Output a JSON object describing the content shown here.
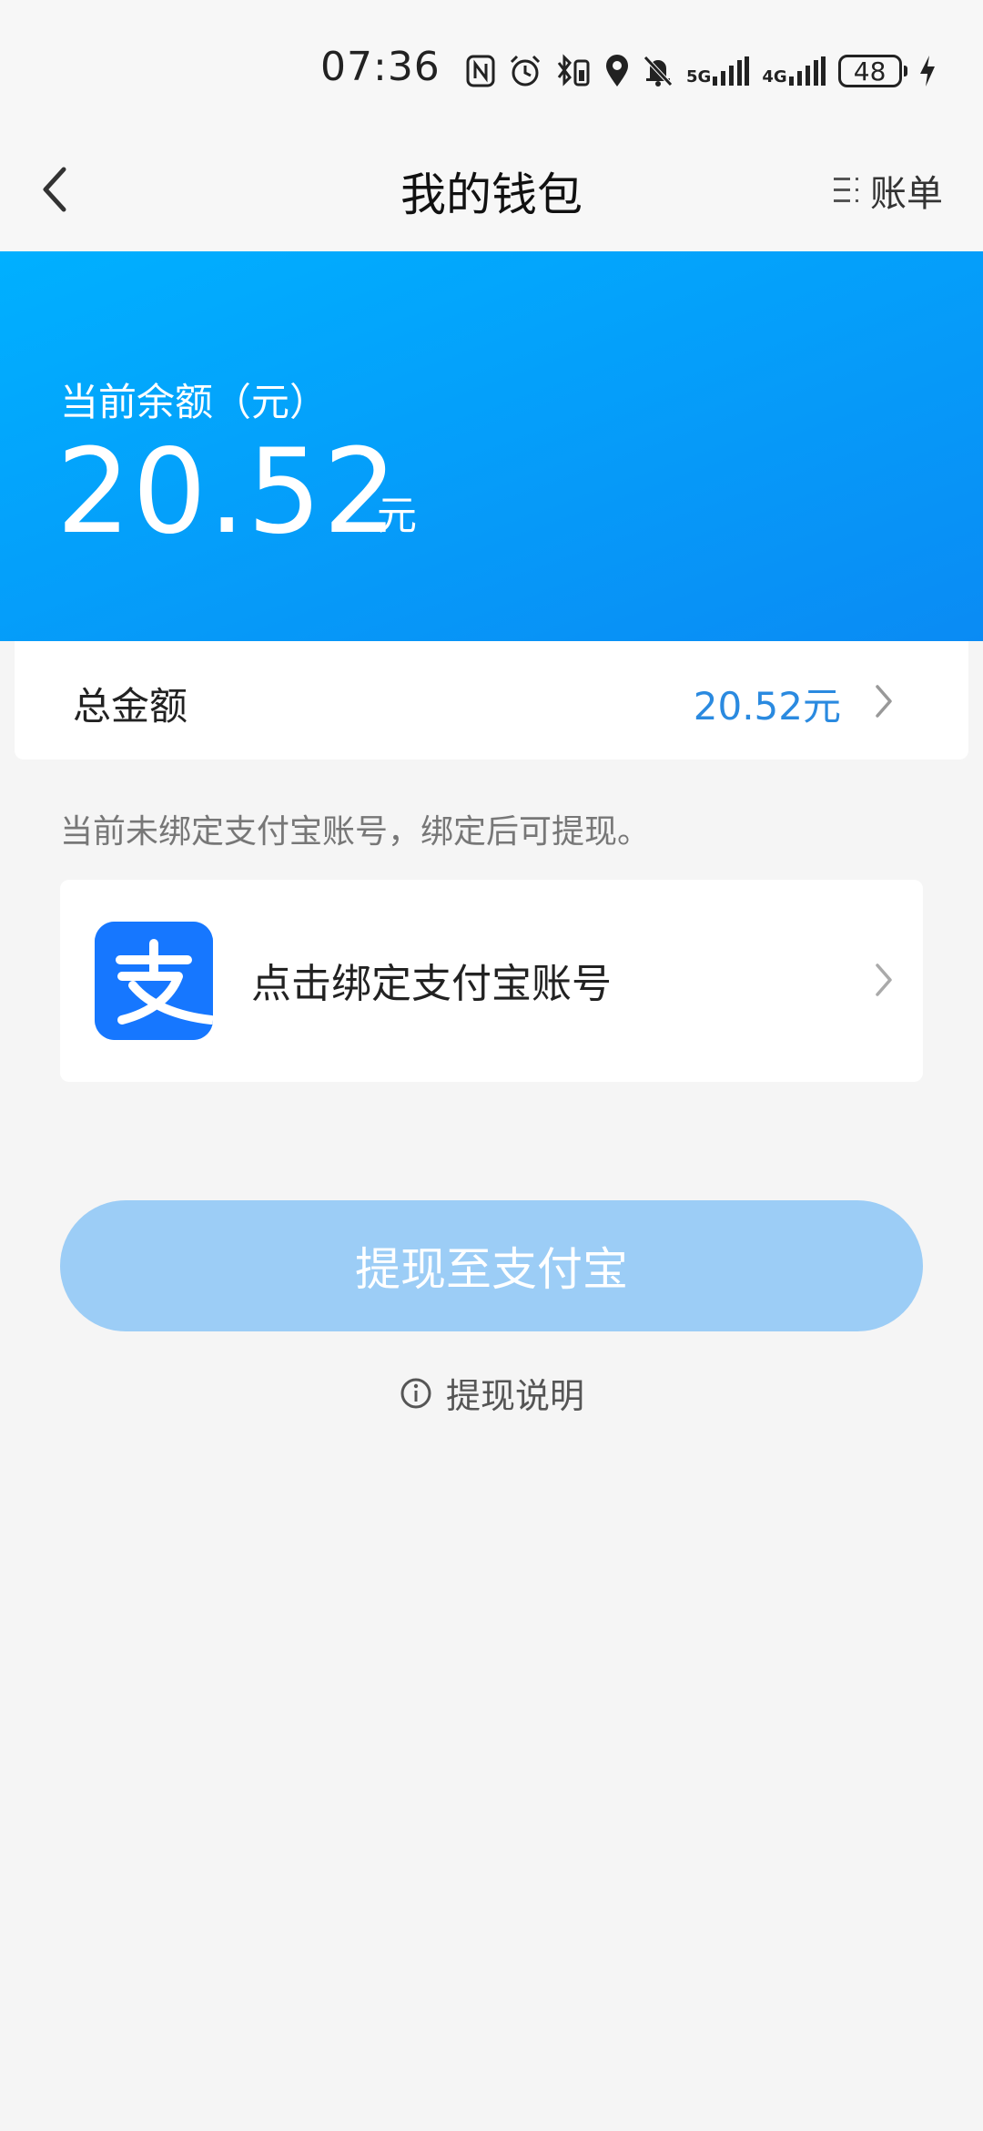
{
  "status_bar": {
    "time": "07:36",
    "network_5g": "5G",
    "network_4g": "4G",
    "battery": "48"
  },
  "nav": {
    "title": "我的钱包",
    "bill_label": "账单"
  },
  "balance": {
    "label": "当前余额（元）",
    "amount": "20.52",
    "unit": "元"
  },
  "total": {
    "label": "总金额",
    "value": "20.52元"
  },
  "notice": "当前未绑定支付宝账号，绑定后可提现。",
  "bind": {
    "text": "点击绑定支付宝账号",
    "logo_char": "支"
  },
  "withdraw_button": "提现至支付宝",
  "explain_link": "提现说明",
  "colors": {
    "brand_blue": "#0a8bf4",
    "amount_blue": "#2a8ae0",
    "alipay_blue": "#1677ff",
    "button_disabled": "#9ccdf6"
  }
}
